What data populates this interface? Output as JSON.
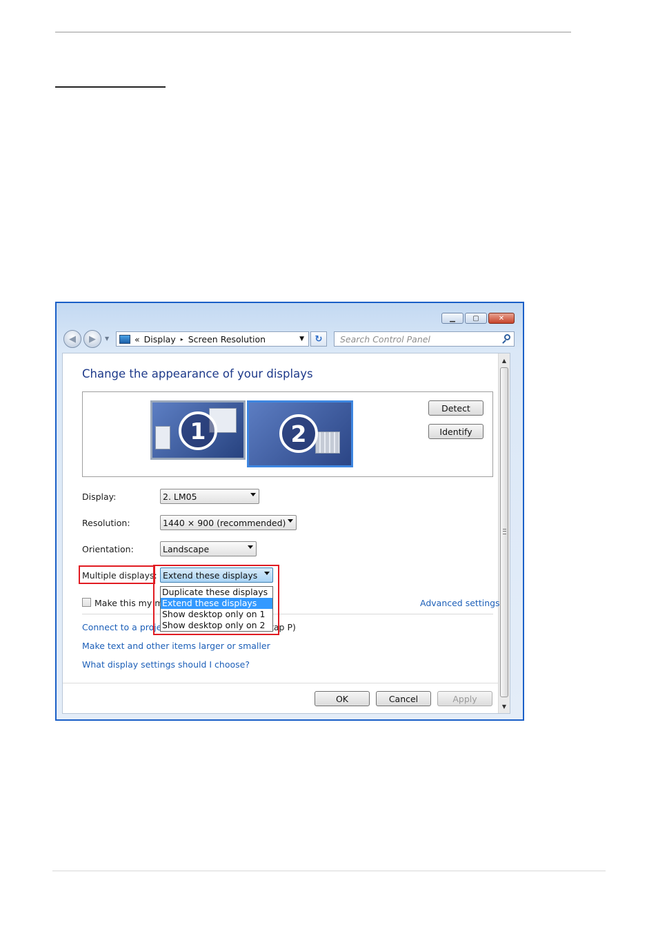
{
  "address_bar": {
    "chevrons": "«",
    "crumbs": [
      "Display",
      "Screen Resolution"
    ],
    "separator": "▸"
  },
  "search": {
    "placeholder": "Search Control Panel"
  },
  "main": {
    "heading": "Change the appearance of your displays",
    "monitors": [
      "1",
      "2"
    ],
    "detect_label": "Detect",
    "identify_label": "Identify",
    "display_label": "Display:",
    "display_value": "2. LM05",
    "resolution_label": "Resolution:",
    "resolution_value": "1440 × 900 (recommended)",
    "orientation_label": "Orientation:",
    "orientation_value": "Landscape",
    "multiple_label": "Multiple displays:",
    "multiple_value": "Extend these displays",
    "multiple_options": [
      "Duplicate these displays",
      "Extend these displays",
      "Show desktop only on 1",
      "Show desktop only on 2"
    ],
    "multiple_selected_index": 1,
    "main_display_checkbox": "Make this my ma",
    "main_display_checked": false,
    "advanced_link": "Advanced settings",
    "projector_link_start": "Connect to a projec",
    "projector_link_end": "tap P)",
    "text_size_link": "Make text and other items larger or smaller",
    "help_link": "What display settings should I choose?"
  },
  "buttons": {
    "ok": "OK",
    "cancel": "Cancel",
    "apply": "Apply"
  },
  "colors": {
    "highlight_box": "#e11b22",
    "selection": "#3399ff",
    "link": "#1c5fb8",
    "heading": "#1e3a8a"
  }
}
